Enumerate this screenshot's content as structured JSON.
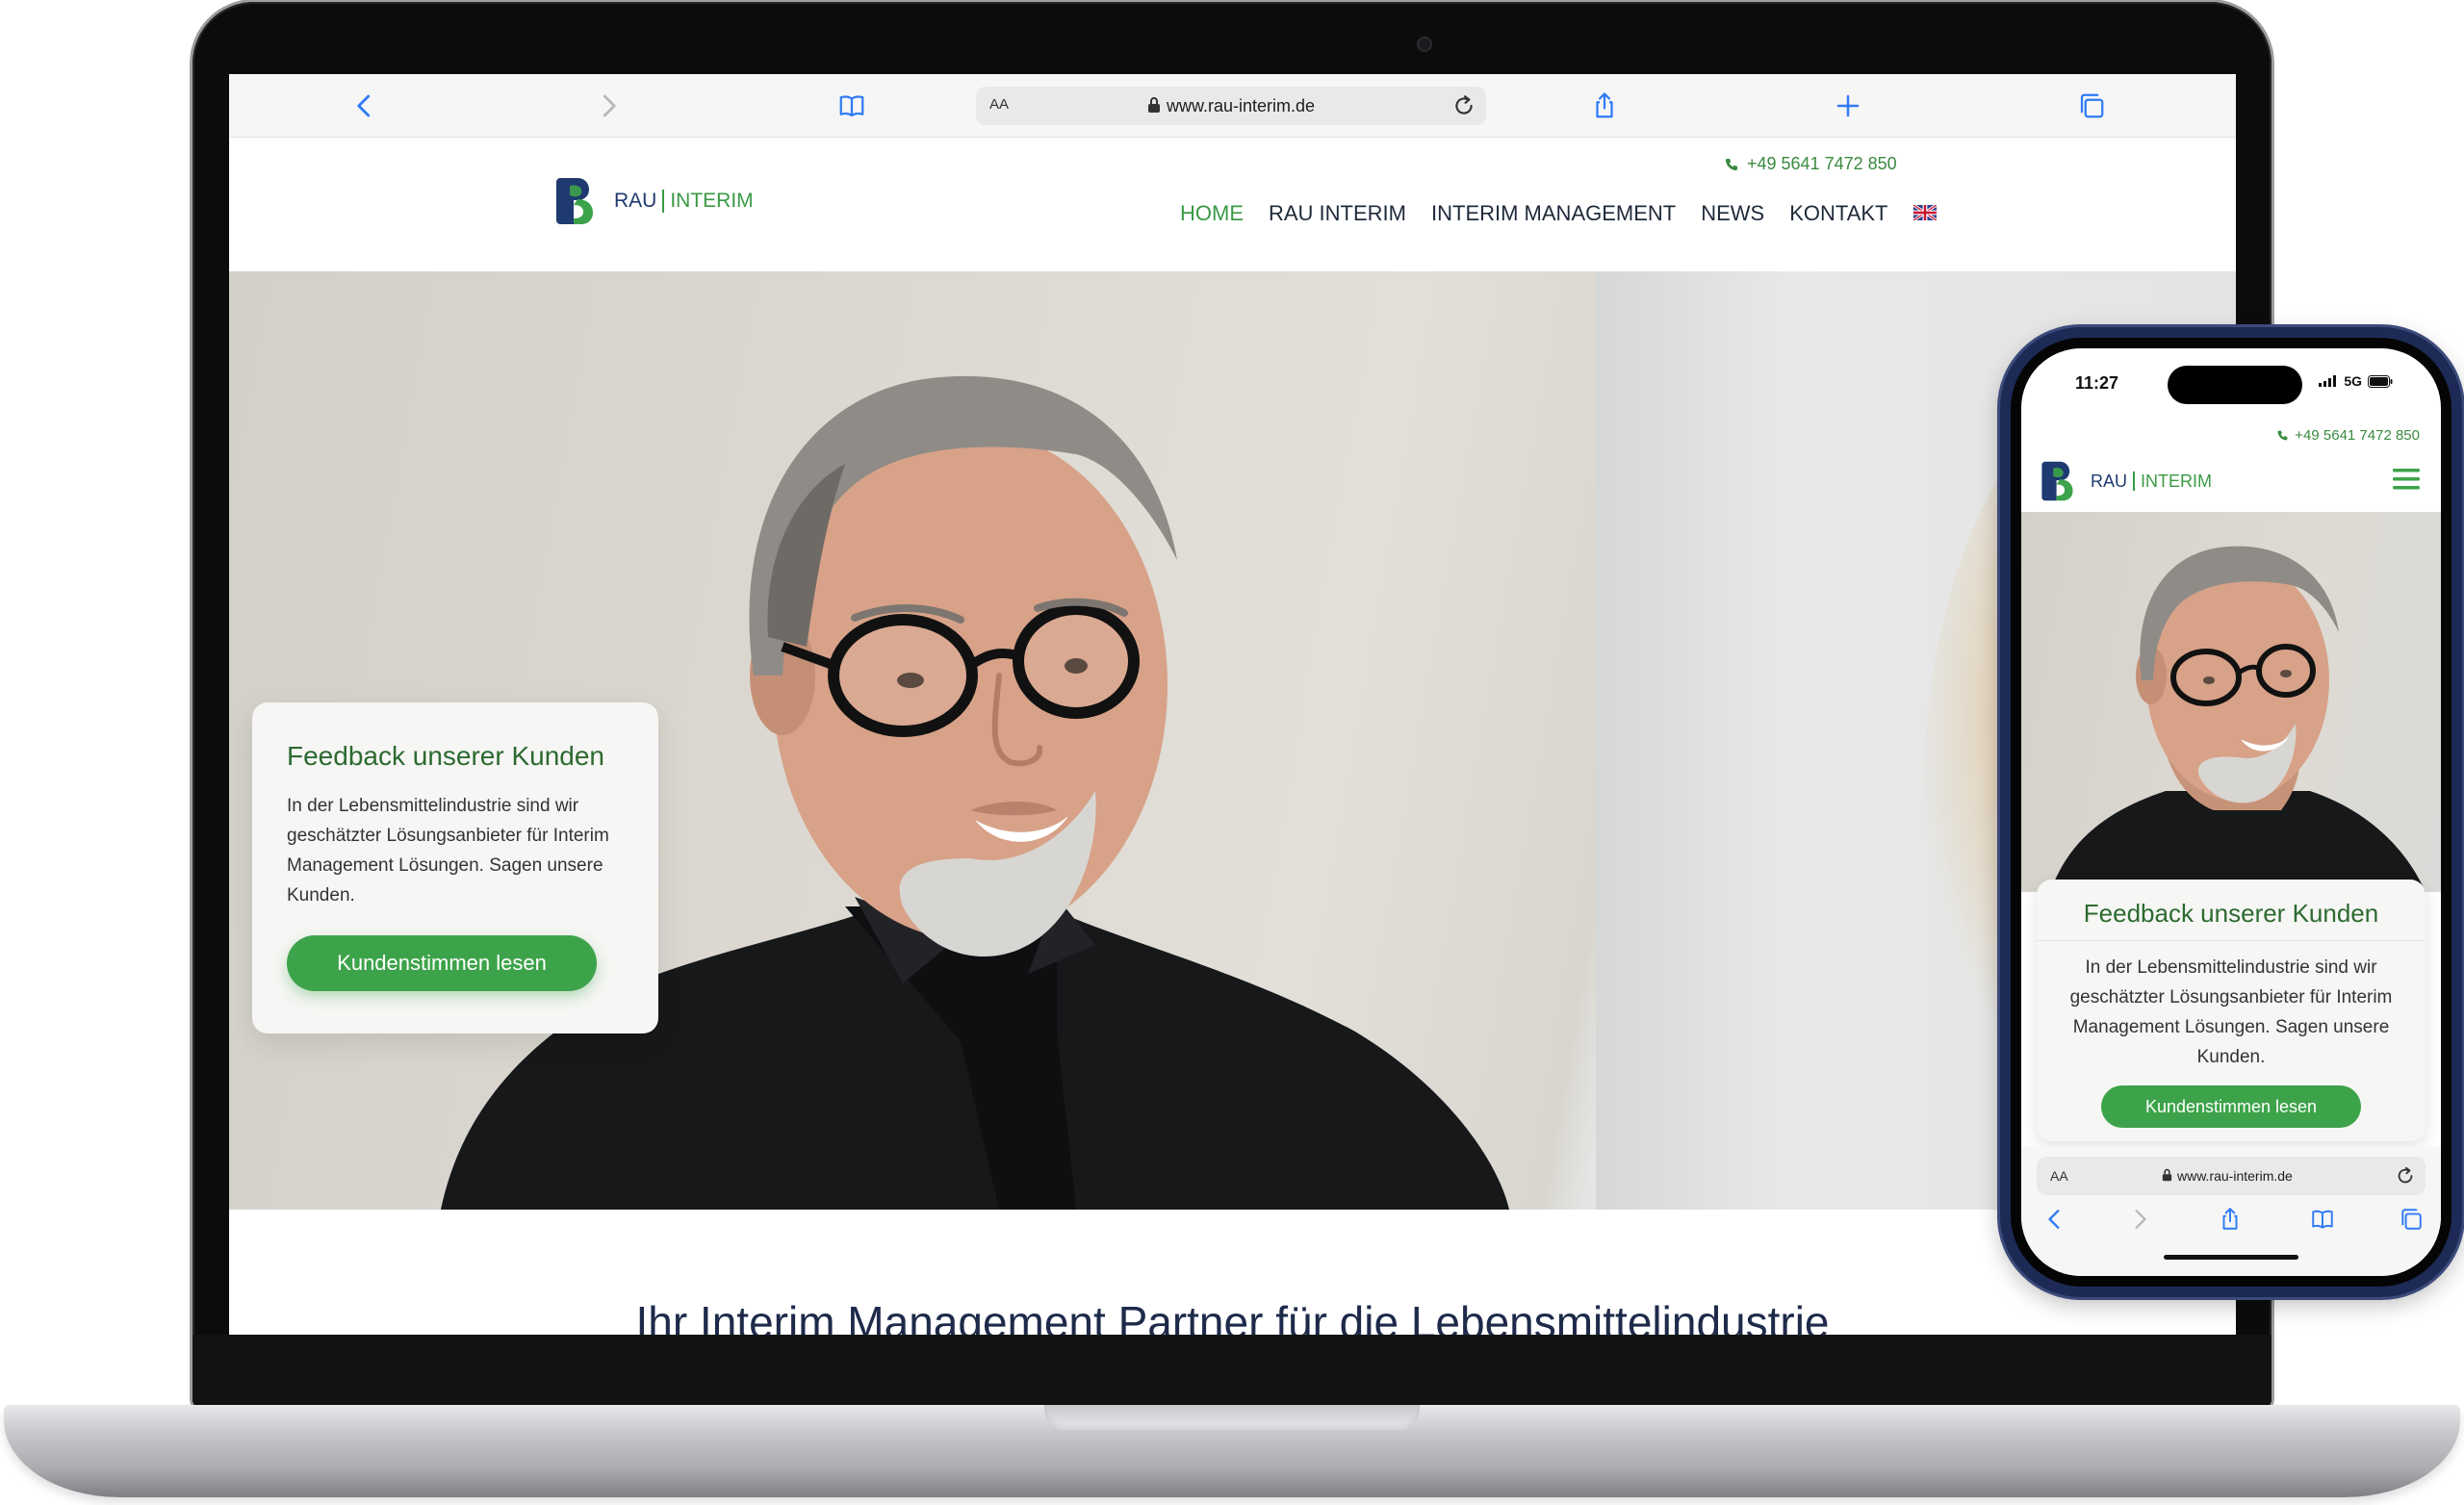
{
  "desktop": {
    "browser": {
      "address_aa": "AA",
      "url": "www.rau-interim.de"
    },
    "site": {
      "phone": "+49 5641 7472 850",
      "logo": {
        "part1": "RAU",
        "part2": "INTERIM"
      },
      "nav": [
        {
          "label": "HOME",
          "active": true
        },
        {
          "label": "RAU INTERIM",
          "active": false
        },
        {
          "label": "INTERIM MANAGEMENT",
          "active": false
        },
        {
          "label": "NEWS",
          "active": false
        },
        {
          "label": "KONTAKT",
          "active": false
        }
      ],
      "hero_card": {
        "title": "Feedback unserer Kunden",
        "text": "In der Lebensmittelindustrie sind wir geschätzter Lösungsanbieter für Interim Management Lösungen. Sagen unsere Kunden.",
        "button": "Kundenstimmen lesen"
      },
      "headline": "Ihr Interim Management Partner für die Lebensmittelindustrie"
    }
  },
  "mobile": {
    "status": {
      "time": "11:27",
      "network": "5G"
    },
    "site": {
      "phone": "+49 5641 7472 850",
      "logo": {
        "part1": "RAU",
        "part2": "INTERIM"
      },
      "hero_card": {
        "title": "Feedback unserer Kunden",
        "text": "In der Lebensmittelindustrie sind wir geschätzter Lösungsanbieter für Interim Management Lösungen. Sagen unsere Kunden.",
        "button": "Kundenstimmen lesen"
      }
    },
    "browser": {
      "address_aa": "AA",
      "url": "www.rau-interim.de"
    }
  },
  "colors": {
    "brand_green": "#3da34a",
    "brand_blue": "#1f3a70",
    "heading_green": "#2c6a31"
  }
}
